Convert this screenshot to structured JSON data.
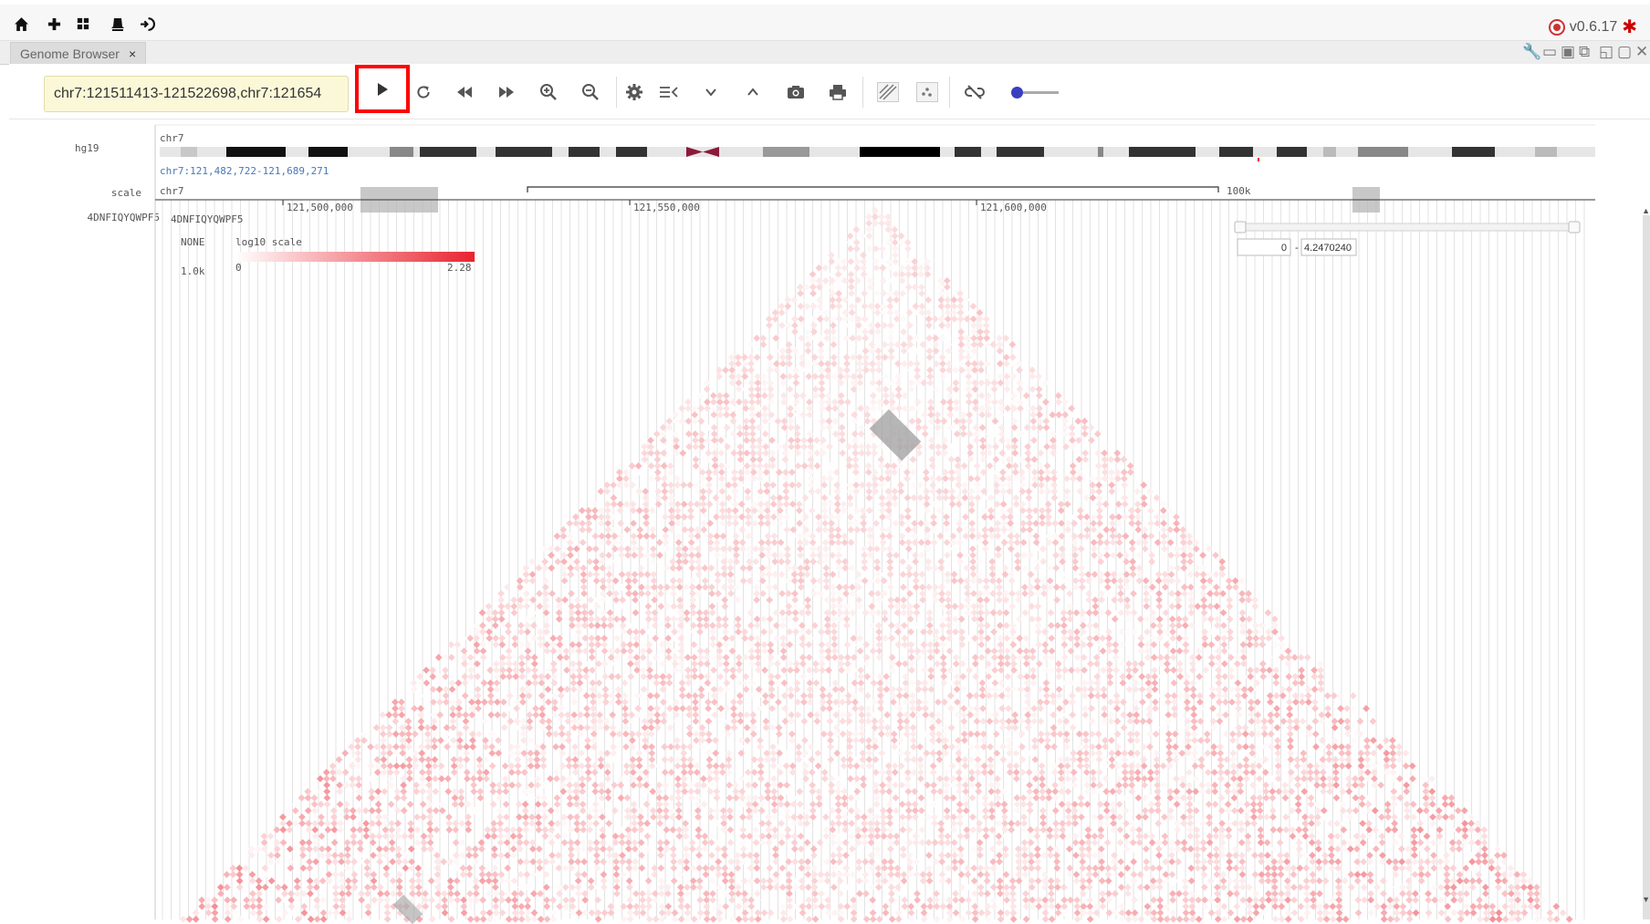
{
  "app": {
    "version": "v0.6.17",
    "nav_icons": [
      "home-icon",
      "plus-icon",
      "grid-icon",
      "bell-icon",
      "logout-icon"
    ]
  },
  "tabs": [
    {
      "label": "Genome Browser",
      "close": "×"
    }
  ],
  "toolbar": {
    "locus": "chr7:121511413-121522698,chr7:121654",
    "buttons": [
      "play-icon",
      "refresh-icon",
      "rewind-icon",
      "fast-forward-icon",
      "zoom-in-icon",
      "zoom-out-icon",
      "gear-icon",
      "list-icon",
      "chevron-down-icon",
      "chevron-up-icon",
      "camera-icon",
      "print-icon",
      "stripes-icon",
      "dots-icon",
      "unlink-icon"
    ],
    "slider_value": 0.1
  },
  "tracks": {
    "genome_label": "hg19",
    "scale_label": "scale",
    "hic_label": "4DNFIQYQWPF5",
    "chrom_name": "chr7",
    "coord_range": "chr7:121,482,722-121,689,271",
    "scale_chrom": "chr7",
    "ticks": [
      "121,500,000",
      "121,550,000",
      "121,600,000"
    ],
    "scale_bar_label": "100k",
    "hic": {
      "title": "4DNFIQYQWPF5",
      "norm": "NONE",
      "scale_name": "log10 scale",
      "resolution": "1.0k",
      "min_label": "0",
      "max_label": "2.28",
      "range_min": "0",
      "range_sep": "-",
      "range_max": "4.2470240"
    }
  },
  "colors": {
    "accent": "#3a3fbf",
    "highlight_red": "#ff0000",
    "heat_max": "#e8232e",
    "locus_bg": "#fbf8d8",
    "coord_text": "#4a79b5"
  }
}
